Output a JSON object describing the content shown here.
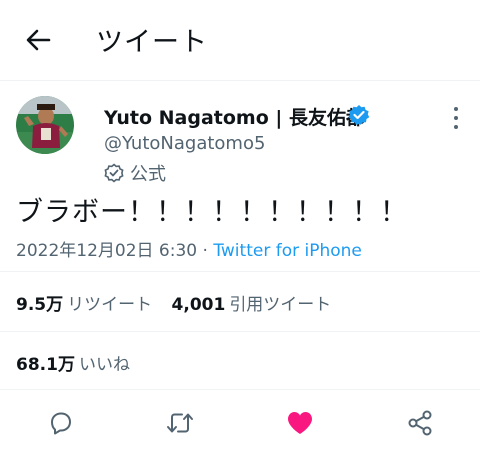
{
  "header": {
    "title": "ツイート",
    "back_icon": "arrow-left-icon"
  },
  "tweet": {
    "display_name": "Yuto Nagatomo | 長友佑都",
    "handle": "@YutoNagatomo5",
    "official_label": "公式",
    "text": "ブラボー！！！！！！！！！！",
    "timestamp": "2022年12月02日 6:30",
    "separator": " · ",
    "source": "Twitter for iPhone"
  },
  "stats": {
    "retweets_count": "9.5万",
    "retweets_label": "リツイート",
    "quotes_count": "4,001",
    "quotes_label": "引用ツイート",
    "likes_count": "68.1万",
    "likes_label": "いいね"
  },
  "colors": {
    "accent": "#1d9bf0",
    "like": "#f91880",
    "secondary_text": "#536471",
    "divider": "#eff3f4"
  },
  "icons": {
    "verified": "verified-badge-icon",
    "official": "official-check-icon",
    "more": "more-vertical-icon",
    "reply": "reply-icon",
    "retweet": "retweet-icon",
    "like": "heart-icon",
    "share": "share-icon"
  }
}
